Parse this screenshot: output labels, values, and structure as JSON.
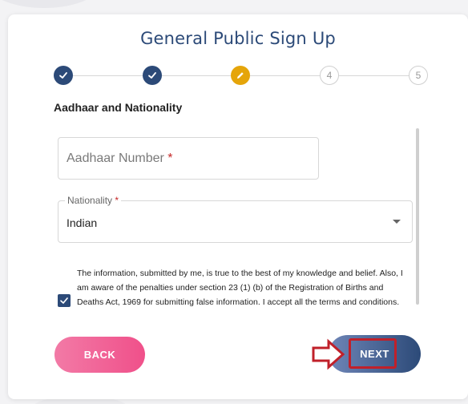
{
  "form": {
    "title": "General Public Sign Up",
    "section_title": "Aadhaar and Nationality",
    "stepper": {
      "steps": [
        {
          "label": "",
          "state": "done"
        },
        {
          "label": "",
          "state": "done"
        },
        {
          "label": "",
          "state": "active"
        },
        {
          "label": "4",
          "state": "pending"
        },
        {
          "label": "5",
          "state": "pending"
        }
      ]
    },
    "aadhaar": {
      "placeholder": "Aadhaar Number",
      "required_mark": "*",
      "value": ""
    },
    "nationality": {
      "label": "Nationality",
      "required_mark": "*",
      "selected": "Indian"
    },
    "declaration": {
      "checked": true,
      "text": "The information, submitted by me, is true to the best of my knowledge and belief. Also, I am aware of the penalties under section 23 (1) (b) of the Registration of Births and Deaths Act, 1969 for submitting false information. I accept all the terms and conditions."
    },
    "buttons": {
      "back_label": "BACK",
      "next_label": "NEXT"
    }
  },
  "colors": {
    "primary": "#2c4a78",
    "active_step": "#e5a50a",
    "back_gradient_start": "#f27aa6",
    "back_gradient_end": "#f0508a",
    "annotation_red": "#c0202a"
  }
}
